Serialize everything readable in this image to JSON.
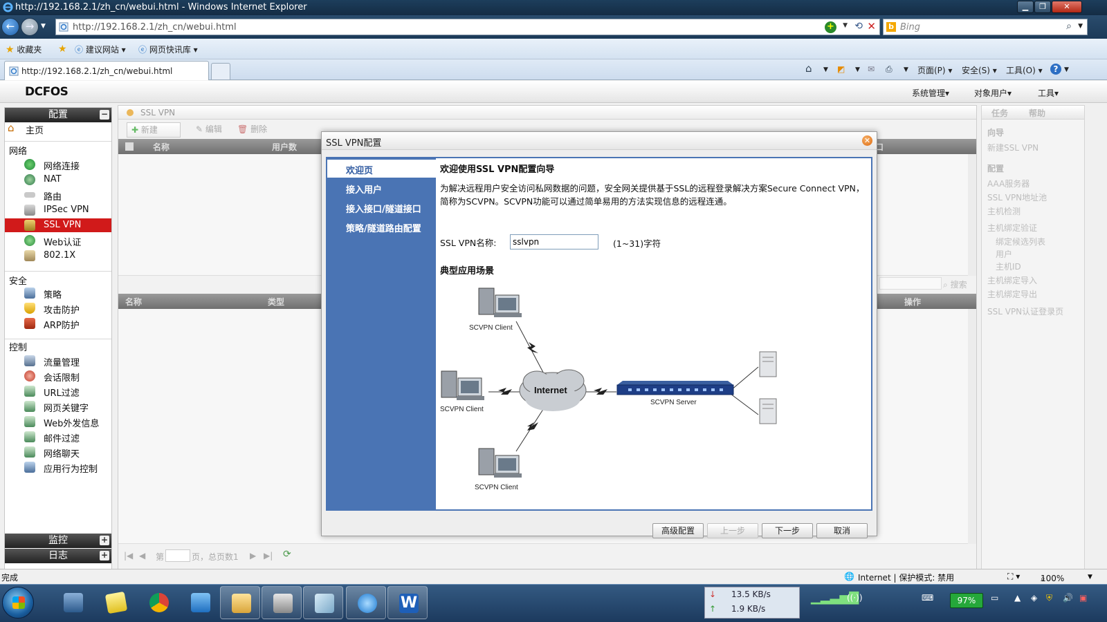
{
  "browser": {
    "window_title": "http://192.168.2.1/zh_cn/webui.html - Windows Internet Explorer",
    "url": "http://192.168.2.1/zh_cn/webui.html",
    "search_placeholder": "Bing",
    "favorites": {
      "label": "收藏夹",
      "items": [
        "建议网站",
        "网页快讯库"
      ]
    },
    "tab_title": "http://192.168.2.1/zh_cn/webui.html",
    "command_menus": [
      "页面(P)",
      "安全(S)",
      "工具(O)"
    ],
    "status": {
      "left": "完成",
      "zone": "Internet | 保护模式: 禁用",
      "zoom": "100%"
    }
  },
  "app": {
    "logo": "DCFOS",
    "top_menu": [
      "系统管理",
      "对象用户",
      "工具"
    ]
  },
  "sidebar": {
    "config_header": "配置",
    "home": "主页",
    "sections": [
      {
        "title": "网络",
        "items": [
          "网络连接",
          "NAT",
          "路由",
          "IPSec VPN",
          "SSL VPN",
          "Web认证",
          "802.1X"
        ]
      },
      {
        "title": "安全",
        "items": [
          "策略",
          "攻击防护",
          "ARP防护"
        ]
      },
      {
        "title": "控制",
        "items": [
          "流量管理",
          "会话限制",
          "URL过滤",
          "网页关键字",
          "Web外发信息",
          "邮件过滤",
          "网络聊天",
          "应用行为控制"
        ]
      }
    ],
    "active_item": "SSL VPN",
    "monitor_header": "监控",
    "log_header": "日志"
  },
  "panel": {
    "title": "SSL VPN",
    "toolbar": [
      "新建",
      "编辑",
      "删除"
    ],
    "grid1_columns": [
      "名称",
      "用户数"
    ],
    "grid1_right_column": "口",
    "search_label": "搜索",
    "grid2_columns": [
      "名称",
      "类型"
    ],
    "grid2_right_column": "操作",
    "pager": {
      "page_prefix": "第",
      "page_suffix": "页，总页数1"
    }
  },
  "right_panel": {
    "tabs": [
      "任务",
      "帮助"
    ],
    "guide_title": "向导",
    "guide_items": [
      "新建SSL VPN"
    ],
    "config_title": "配置",
    "config_items": [
      "AAA服务器",
      "SSL VPN地址池",
      "主机检测",
      "主机绑定验证"
    ],
    "binding_items": [
      "绑定候选列表",
      "用户",
      "主机ID"
    ],
    "more_items": [
      "主机绑定导入",
      "主机绑定导出",
      "SSL VPN认证登录页"
    ]
  },
  "dialog": {
    "title": "SSL VPN配置",
    "steps": [
      "欢迎页",
      "接入用户",
      "接入接口/隧道接口",
      "策略/隧道路由配置"
    ],
    "current_step": "欢迎页",
    "welcome_title": "欢迎使用SSL VPN配置向导",
    "description": "为解决远程用户安全访问私网数据的问题，安全网关提供基于SSL的远程登录解决方案Secure Connect VPN，简称为SCVPN。SCVPN功能可以通过简单易用的方法实现信息的远程连通。",
    "name_label": "SSL VPN名称:",
    "name_value": "sslvpn",
    "name_hint": "(1~31)字符",
    "scenario_title": "典型应用场景",
    "diagram": {
      "client_label": "SCVPN Client",
      "internet_label": "Internet",
      "server_label": "SCVPN Server"
    },
    "buttons": {
      "advanced": "高级配置",
      "prev": "上一步",
      "next": "下一步",
      "cancel": "取消"
    }
  },
  "taskbar": {
    "net_down": "13.5 KB/s",
    "net_up": "1.9 KB/s",
    "battery": "97%"
  }
}
